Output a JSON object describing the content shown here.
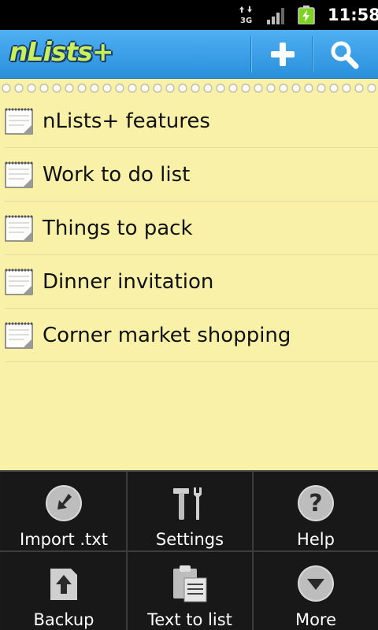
{
  "status_bar": {
    "network": "3G",
    "time": "11:58",
    "icons": [
      "data-arrows-icon",
      "signal-icon",
      "battery-charging-icon"
    ]
  },
  "action_bar": {
    "app_name": "nLists+",
    "buttons": [
      {
        "name": "add-icon"
      },
      {
        "name": "search-icon"
      }
    ],
    "colors": {
      "background": "#3a9fe6",
      "logo": "#c7f05a"
    }
  },
  "lists": {
    "items": [
      {
        "label": "nLists+ features",
        "icon": "note-icon"
      },
      {
        "label": "Work to do list",
        "icon": "note-icon"
      },
      {
        "label": "Things to pack",
        "icon": "note-icon"
      },
      {
        "label": "Dinner invitation",
        "icon": "note-icon"
      },
      {
        "label": "Corner market shopping",
        "icon": "note-icon"
      }
    ],
    "background": "#f8f1a7"
  },
  "menu": {
    "items": [
      {
        "label": "Import .txt",
        "icon": "import-icon"
      },
      {
        "label": "Settings",
        "icon": "tools-icon"
      },
      {
        "label": "Help",
        "icon": "help-icon"
      },
      {
        "label": "Backup",
        "icon": "backup-icon"
      },
      {
        "label": "Text to list",
        "icon": "clipboard-icon"
      },
      {
        "label": "More",
        "icon": "more-icon"
      }
    ]
  }
}
